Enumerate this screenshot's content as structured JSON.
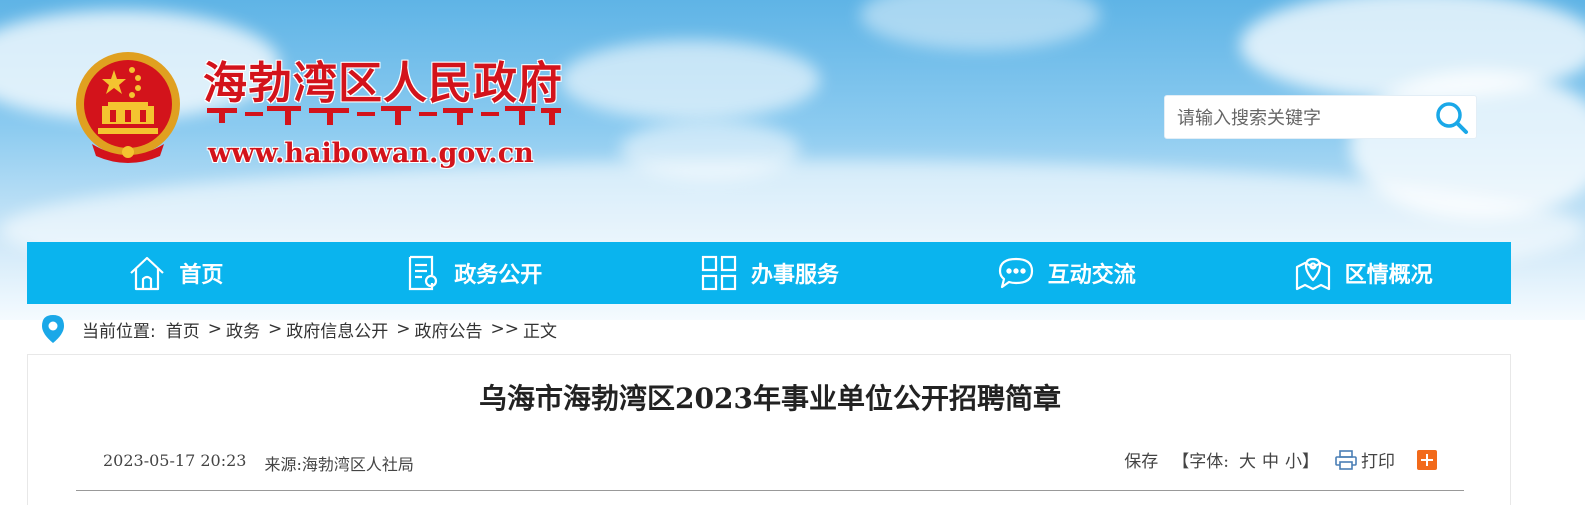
{
  "header": {
    "site_name": "海勃湾区人民政府",
    "site_url": "www.haibowan.gov.cn",
    "brand_color": "#d3131b"
  },
  "search": {
    "placeholder": "请输入搜索关键字",
    "icon": "search-icon"
  },
  "nav": {
    "color": "#0ab4ee",
    "items": [
      {
        "label": "首页",
        "icon": "home-icon"
      },
      {
        "label": "政务公开",
        "icon": "document-icon"
      },
      {
        "label": "办事服务",
        "icon": "grid-icon"
      },
      {
        "label": "互动交流",
        "icon": "chat-icon"
      },
      {
        "label": "区情概况",
        "icon": "map-pin-icon"
      }
    ]
  },
  "breadcrumb": {
    "prefix": "当前位置:",
    "items": [
      "首页",
      "政务",
      "政府信息公开",
      "政府公告",
      "正文"
    ],
    "sep": ">",
    "last_sep": ">>"
  },
  "article": {
    "title": "乌海市海勃湾区2023年事业单位公开招聘简章",
    "date": "2023-05-17 20:23",
    "source": "来源:海勃湾区人社局",
    "tools": {
      "save": "保存",
      "font_open": "【字体:",
      "font_large": "大",
      "font_medium": "中",
      "font_small": "小",
      "font_close": "】",
      "print": "打印"
    }
  }
}
